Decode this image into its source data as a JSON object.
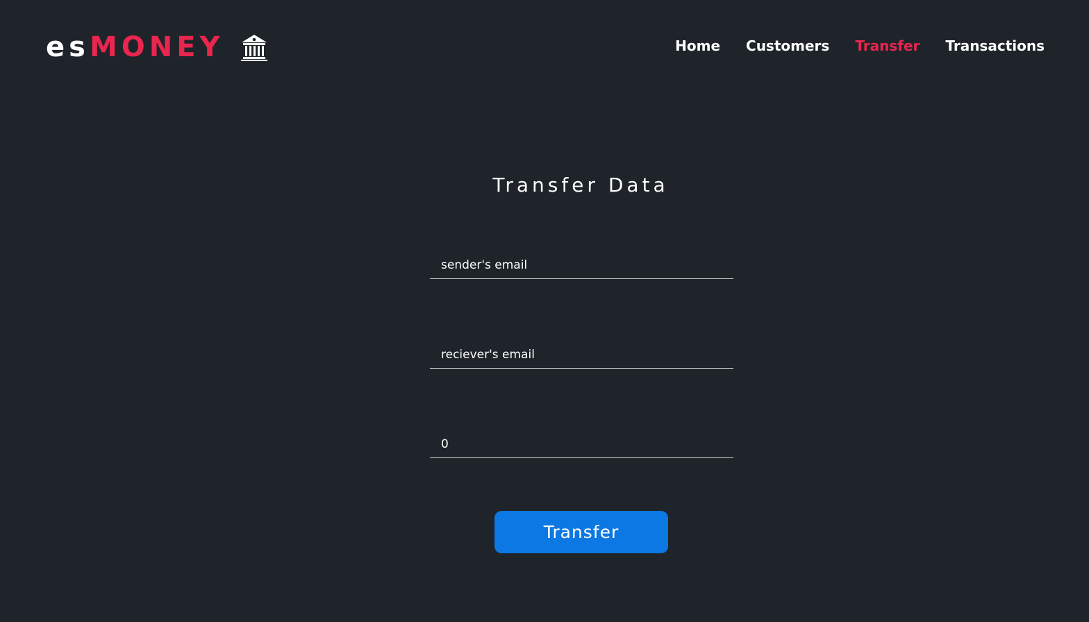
{
  "brand": {
    "prefix": "es",
    "name": "MONEY",
    "icon": "bank-icon",
    "prefix_color": "#ffffff",
    "accent_color": "#e8264f"
  },
  "nav": {
    "items": [
      {
        "label": "Home",
        "active": false
      },
      {
        "label": "Customers",
        "active": false
      },
      {
        "label": "Transfer",
        "active": true
      },
      {
        "label": "Transactions",
        "active": false
      }
    ]
  },
  "form": {
    "title": "Transfer Data",
    "sender": {
      "placeholder": "sender's email",
      "value": ""
    },
    "receiver": {
      "placeholder": "reciever's email",
      "value": ""
    },
    "amount": {
      "value": "0"
    },
    "submit_label": "Transfer",
    "submit_color": "#0b78e3"
  },
  "colors": {
    "background": "#1e2429",
    "accent": "#e8264f",
    "button": "#0b78e3"
  }
}
